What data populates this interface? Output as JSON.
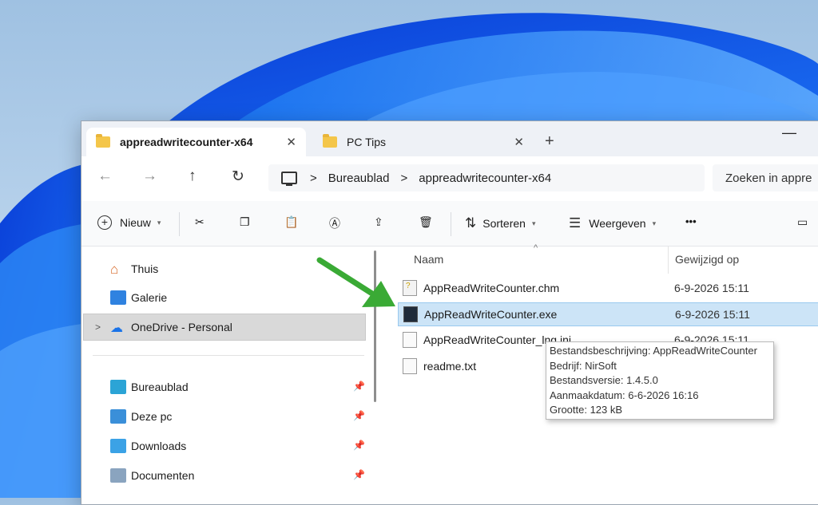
{
  "tabs": [
    {
      "label": "appreadwritecounter-x64",
      "close": "✕"
    },
    {
      "label": "PC Tips",
      "close": "✕"
    }
  ],
  "new_tab_label": "+",
  "window_minimize": "—",
  "nav": {
    "back": "←",
    "forward": "→",
    "up": "↑",
    "refresh": "↻",
    "breadcrumb": [
      "Bureaublad",
      "appreadwritecounter-x64"
    ],
    "separator": ">",
    "search_placeholder": "Zoeken in appre"
  },
  "toolbar": {
    "new_label": "Nieuw",
    "sort_label": "Sorteren",
    "view_label": "Weergeven",
    "more_label": "•••"
  },
  "sidebar": {
    "items": [
      {
        "label": "Thuis"
      },
      {
        "label": "Galerie"
      },
      {
        "label": "OneDrive - Personal",
        "expand": ">"
      }
    ],
    "quick_access": [
      {
        "label": "Bureaublad"
      },
      {
        "label": "Deze pc"
      },
      {
        "label": "Downloads"
      },
      {
        "label": "Documenten"
      }
    ]
  },
  "columns": {
    "name": "Naam",
    "modified": "Gewijzigd op",
    "sort_caret": "^"
  },
  "files": [
    {
      "name": "AppReadWriteCounter.chm",
      "date": "6-9-2026 15:11",
      "icon": "help-file-icon"
    },
    {
      "name": "AppReadWriteCounter.exe",
      "date": "6-9-2026 15:11",
      "icon": "exe-file-icon",
      "selected": true
    },
    {
      "name": "AppReadWriteCounter_lng.ini",
      "date": "6-9-2026 15:11",
      "icon": "ini-file-icon"
    },
    {
      "name": "readme.txt",
      "date": "",
      "icon": "text-file-icon"
    }
  ],
  "tooltip": {
    "line1": "Bestandsbeschrijving: AppReadWriteCounter",
    "line2": "Bedrijf: NirSoft",
    "line3": "Bestandsversie: 1.4.5.0",
    "line4": "Aanmaakdatum: 6-6-2026 16:16",
    "line5": "Grootte: 123 kB"
  },
  "colors": {
    "accent": "#0067c0",
    "selection": "#cce4f7",
    "arrow": "#3aaa35"
  }
}
